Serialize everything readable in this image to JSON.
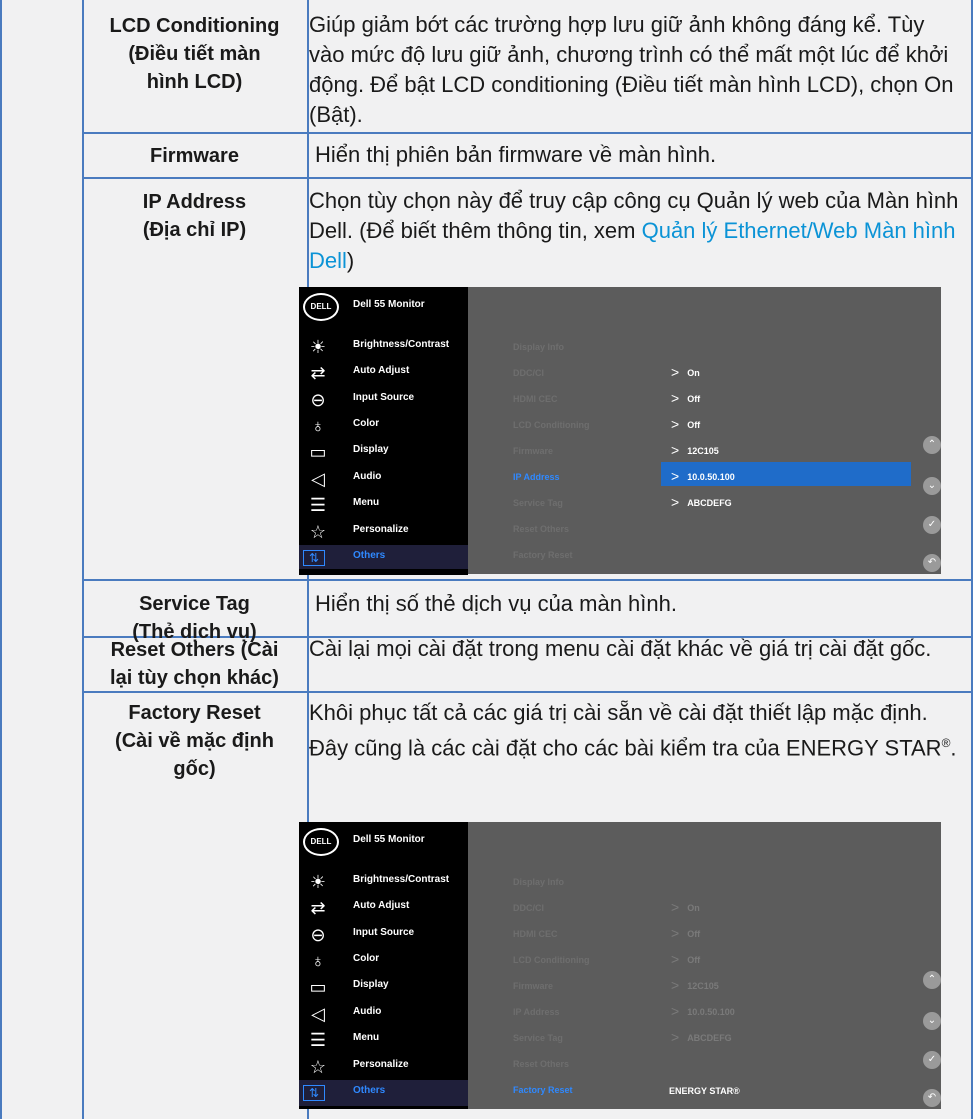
{
  "rows": [
    {
      "label": "LCD Conditioning\n(Điều tiết màn\nhình LCD)",
      "desc": "Giúp giảm bớt các trường hợp lưu giữ ảnh không đáng kể. Tùy vào mức độ lưu giữ ảnh, chương trình có thể mất một lúc để khởi động. Để bật LCD conditioning (Điều tiết màn hình LCD), chọn On (Bật)."
    },
    {
      "label": "Firmware",
      "desc": "Hiển thị phiên bản firmware về màn hình."
    },
    {
      "label": "IP Address\n(Địa chỉ IP)",
      "desc": "Chọn tùy chọn này để truy cập công cụ Quản lý web của Màn hình Dell. (Để biết thêm thông tin, xem ",
      "link": "Quản lý Ethernet/Web Màn hình Dell",
      "desc_end": ")"
    },
    {
      "label": "Service Tag\n(Thẻ dịch vụ)",
      "desc": "Hiển thị số thẻ dịch vụ của màn hình."
    },
    {
      "label": "Reset Others (Cài\nlại tùy chọn khác)",
      "desc": "Cài lại mọi cài đặt trong menu cài đặt khác về giá trị cài đặt gốc."
    },
    {
      "label": "Factory Reset\n(Cài về mặc định\ngốc)",
      "desc": "Khôi phục tất cả các giá trị cài sẵn về cài đặt thiết lập mặc định. Đây cũng là các cài đặt cho các bài kiểm tra của ENERGY STAR",
      "desc_sup": "®",
      "desc_end": "."
    }
  ],
  "osd": {
    "logo": "DELL",
    "title": "Dell 55 Monitor",
    "menu": [
      "Brightness/Contrast",
      "Auto Adjust",
      "Input Source",
      "Color",
      "Display",
      "Audio",
      "Menu",
      "Personalize",
      "Others"
    ],
    "menu_icons": [
      "brightness-icon",
      "auto-adjust-icon",
      "input-source-icon",
      "color-icon",
      "display-icon",
      "audio-icon",
      "menu-icon",
      "personalize-icon",
      "others-icon"
    ],
    "submenu": [
      "Display Info",
      "DDC/CI",
      "HDMI CEC",
      "LCD Conditioning",
      "Firmware",
      "IP Address",
      "Service Tag",
      "Reset Others",
      "Factory Reset"
    ],
    "values1": [
      "On",
      "Off",
      "Off",
      "12C105",
      "10.0.50.100",
      "ABCDEFG"
    ],
    "values2": [
      "On",
      "Off",
      "Off",
      "12C105",
      "10.0.50.100",
      "ABCDEFG"
    ],
    "energy_star": "ENERGY STAR®",
    "selected1": "IP Address",
    "selected2": "Factory Reset"
  },
  "colors": {
    "link": "#0b93d6",
    "border": "#4a7bbf",
    "highlight": "#1f6cc9",
    "select": "#2f89ff"
  }
}
